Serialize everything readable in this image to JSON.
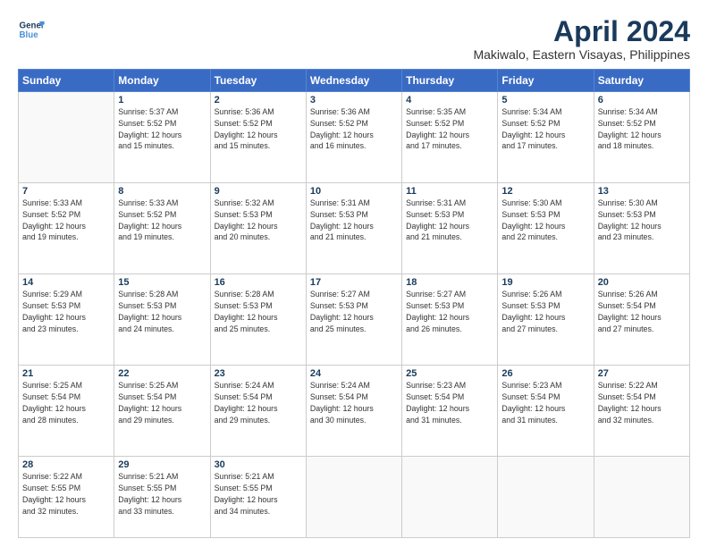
{
  "logo": {
    "line1": "General",
    "line2": "Blue"
  },
  "title": "April 2024",
  "subtitle": "Makiwalo, Eastern Visayas, Philippines",
  "columns": [
    "Sunday",
    "Monday",
    "Tuesday",
    "Wednesday",
    "Thursday",
    "Friday",
    "Saturday"
  ],
  "weeks": [
    [
      {
        "day": "",
        "info": ""
      },
      {
        "day": "1",
        "info": "Sunrise: 5:37 AM\nSunset: 5:52 PM\nDaylight: 12 hours\nand 15 minutes."
      },
      {
        "day": "2",
        "info": "Sunrise: 5:36 AM\nSunset: 5:52 PM\nDaylight: 12 hours\nand 15 minutes."
      },
      {
        "day": "3",
        "info": "Sunrise: 5:36 AM\nSunset: 5:52 PM\nDaylight: 12 hours\nand 16 minutes."
      },
      {
        "day": "4",
        "info": "Sunrise: 5:35 AM\nSunset: 5:52 PM\nDaylight: 12 hours\nand 17 minutes."
      },
      {
        "day": "5",
        "info": "Sunrise: 5:34 AM\nSunset: 5:52 PM\nDaylight: 12 hours\nand 17 minutes."
      },
      {
        "day": "6",
        "info": "Sunrise: 5:34 AM\nSunset: 5:52 PM\nDaylight: 12 hours\nand 18 minutes."
      }
    ],
    [
      {
        "day": "7",
        "info": "Sunrise: 5:33 AM\nSunset: 5:52 PM\nDaylight: 12 hours\nand 19 minutes."
      },
      {
        "day": "8",
        "info": "Sunrise: 5:33 AM\nSunset: 5:52 PM\nDaylight: 12 hours\nand 19 minutes."
      },
      {
        "day": "9",
        "info": "Sunrise: 5:32 AM\nSunset: 5:53 PM\nDaylight: 12 hours\nand 20 minutes."
      },
      {
        "day": "10",
        "info": "Sunrise: 5:31 AM\nSunset: 5:53 PM\nDaylight: 12 hours\nand 21 minutes."
      },
      {
        "day": "11",
        "info": "Sunrise: 5:31 AM\nSunset: 5:53 PM\nDaylight: 12 hours\nand 21 minutes."
      },
      {
        "day": "12",
        "info": "Sunrise: 5:30 AM\nSunset: 5:53 PM\nDaylight: 12 hours\nand 22 minutes."
      },
      {
        "day": "13",
        "info": "Sunrise: 5:30 AM\nSunset: 5:53 PM\nDaylight: 12 hours\nand 23 minutes."
      }
    ],
    [
      {
        "day": "14",
        "info": "Sunrise: 5:29 AM\nSunset: 5:53 PM\nDaylight: 12 hours\nand 23 minutes."
      },
      {
        "day": "15",
        "info": "Sunrise: 5:28 AM\nSunset: 5:53 PM\nDaylight: 12 hours\nand 24 minutes."
      },
      {
        "day": "16",
        "info": "Sunrise: 5:28 AM\nSunset: 5:53 PM\nDaylight: 12 hours\nand 25 minutes."
      },
      {
        "day": "17",
        "info": "Sunrise: 5:27 AM\nSunset: 5:53 PM\nDaylight: 12 hours\nand 25 minutes."
      },
      {
        "day": "18",
        "info": "Sunrise: 5:27 AM\nSunset: 5:53 PM\nDaylight: 12 hours\nand 26 minutes."
      },
      {
        "day": "19",
        "info": "Sunrise: 5:26 AM\nSunset: 5:53 PM\nDaylight: 12 hours\nand 27 minutes."
      },
      {
        "day": "20",
        "info": "Sunrise: 5:26 AM\nSunset: 5:54 PM\nDaylight: 12 hours\nand 27 minutes."
      }
    ],
    [
      {
        "day": "21",
        "info": "Sunrise: 5:25 AM\nSunset: 5:54 PM\nDaylight: 12 hours\nand 28 minutes."
      },
      {
        "day": "22",
        "info": "Sunrise: 5:25 AM\nSunset: 5:54 PM\nDaylight: 12 hours\nand 29 minutes."
      },
      {
        "day": "23",
        "info": "Sunrise: 5:24 AM\nSunset: 5:54 PM\nDaylight: 12 hours\nand 29 minutes."
      },
      {
        "day": "24",
        "info": "Sunrise: 5:24 AM\nSunset: 5:54 PM\nDaylight: 12 hours\nand 30 minutes."
      },
      {
        "day": "25",
        "info": "Sunrise: 5:23 AM\nSunset: 5:54 PM\nDaylight: 12 hours\nand 31 minutes."
      },
      {
        "day": "26",
        "info": "Sunrise: 5:23 AM\nSunset: 5:54 PM\nDaylight: 12 hours\nand 31 minutes."
      },
      {
        "day": "27",
        "info": "Sunrise: 5:22 AM\nSunset: 5:54 PM\nDaylight: 12 hours\nand 32 minutes."
      }
    ],
    [
      {
        "day": "28",
        "info": "Sunrise: 5:22 AM\nSunset: 5:55 PM\nDaylight: 12 hours\nand 32 minutes."
      },
      {
        "day": "29",
        "info": "Sunrise: 5:21 AM\nSunset: 5:55 PM\nDaylight: 12 hours\nand 33 minutes."
      },
      {
        "day": "30",
        "info": "Sunrise: 5:21 AM\nSunset: 5:55 PM\nDaylight: 12 hours\nand 34 minutes."
      },
      {
        "day": "",
        "info": ""
      },
      {
        "day": "",
        "info": ""
      },
      {
        "day": "",
        "info": ""
      },
      {
        "day": "",
        "info": ""
      }
    ]
  ]
}
